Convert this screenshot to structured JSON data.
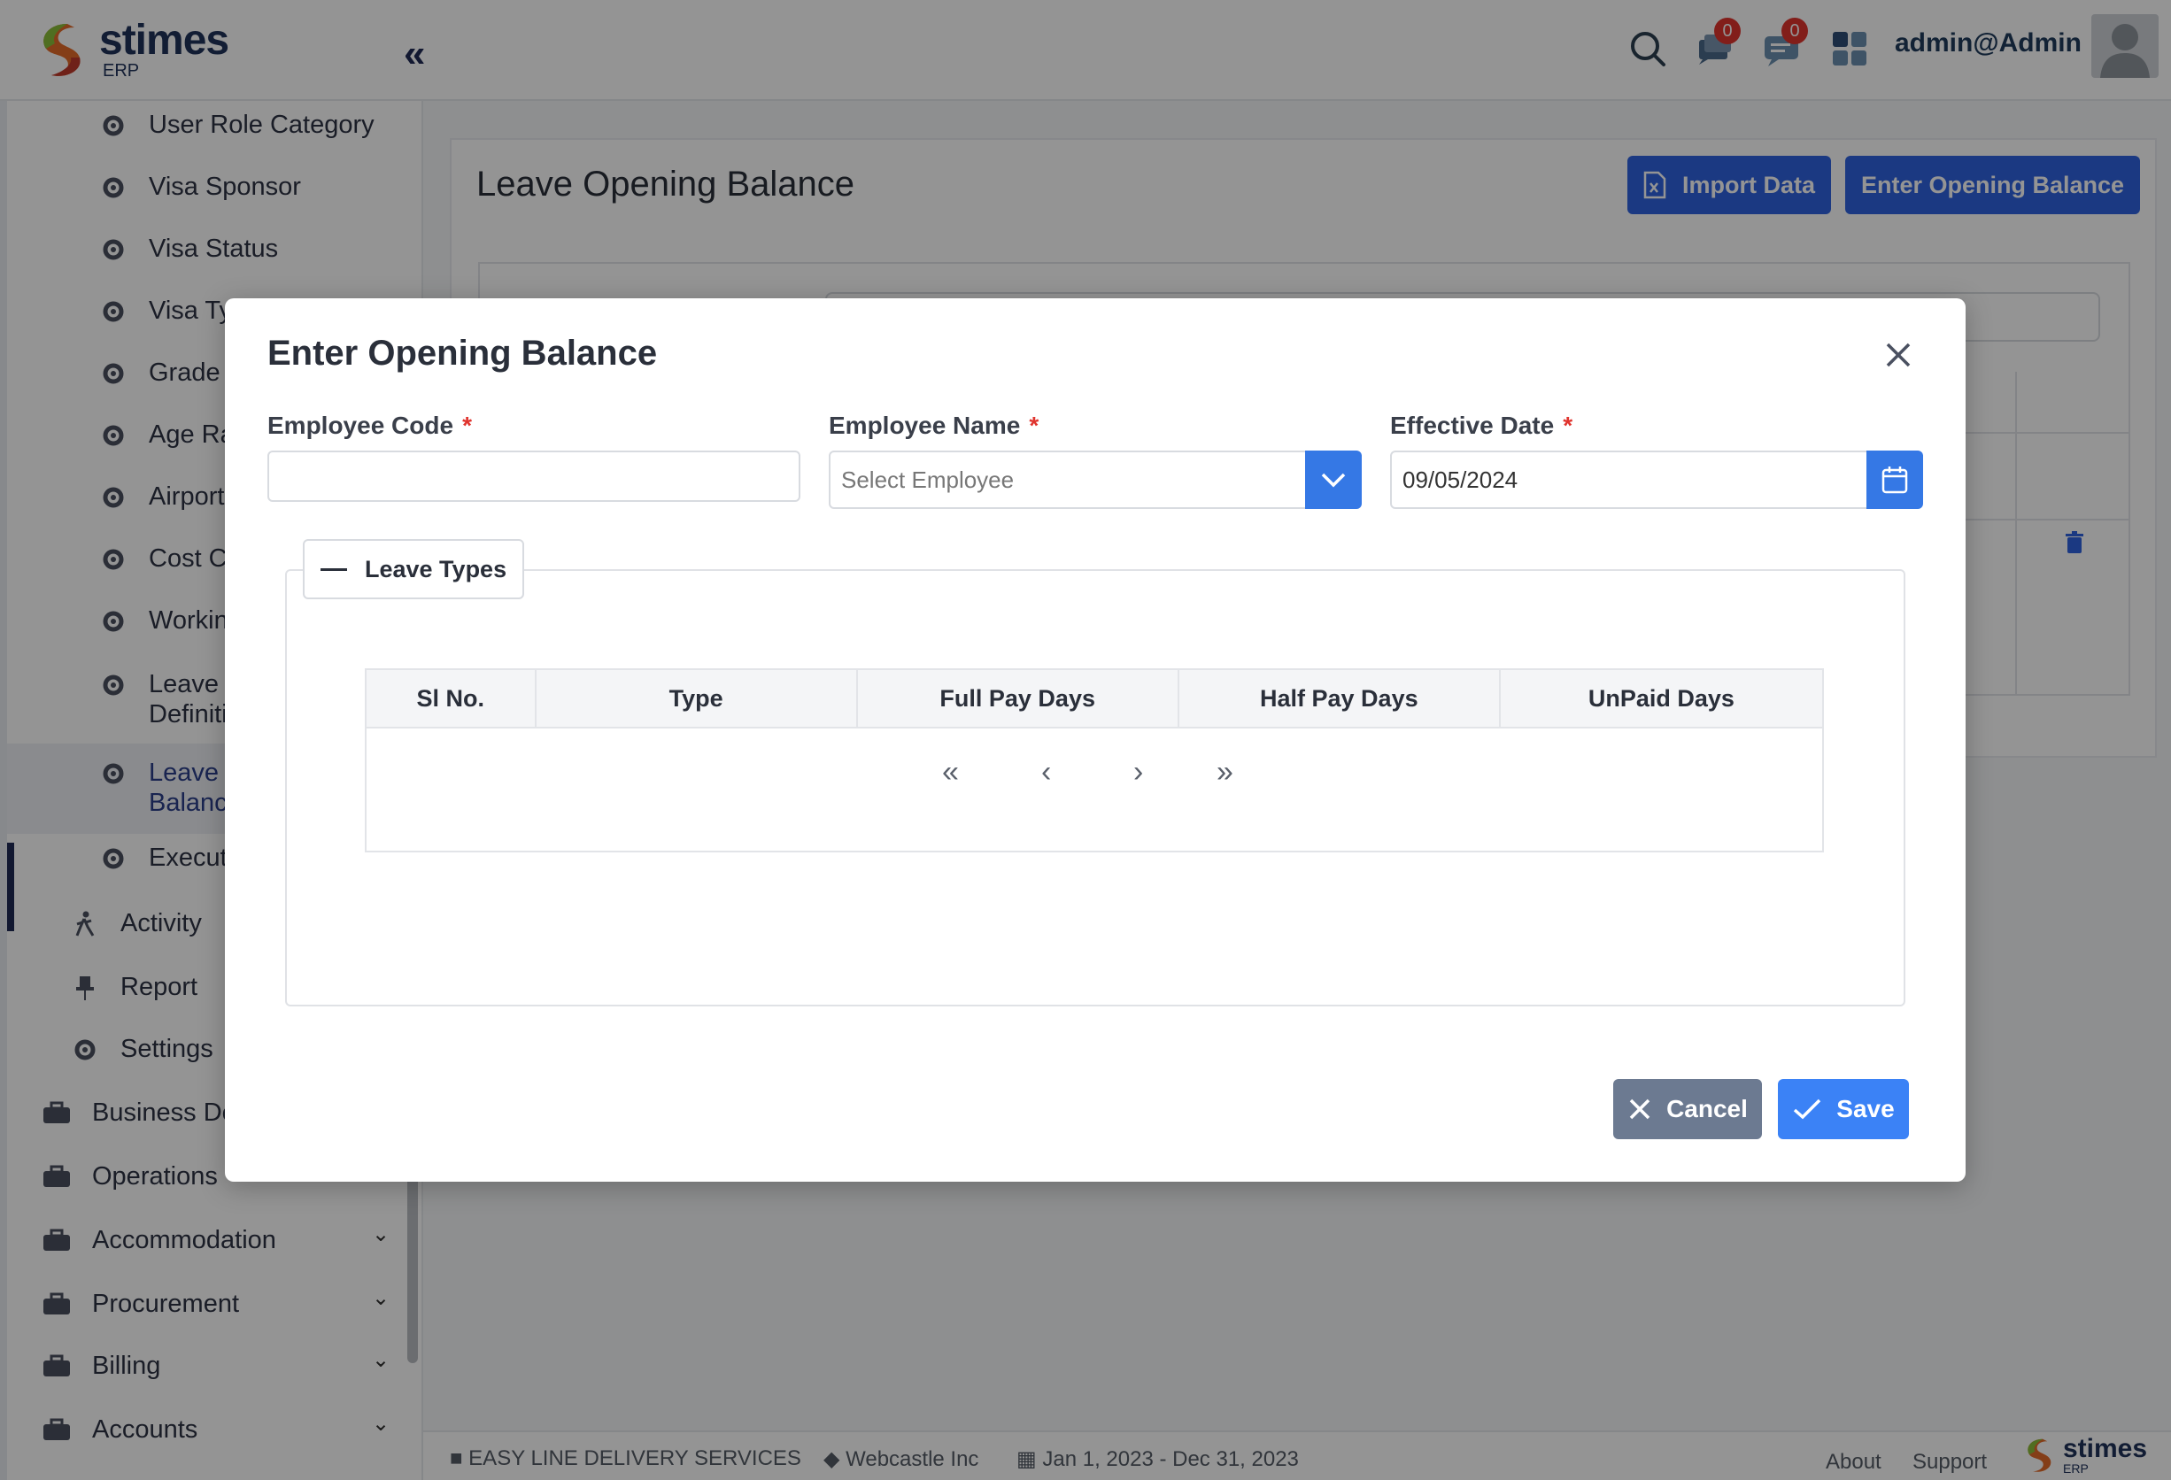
{
  "app": {
    "logo_text": "stimes",
    "logo_sub": "ERP",
    "collapse_icon": "«"
  },
  "header": {
    "notifications_count": "0",
    "messages_count": "0",
    "user": "admin@Admin"
  },
  "sidebar": {
    "items": [
      {
        "label": "User Role Category",
        "icon": "gear-icon"
      },
      {
        "label": "Visa Sponsor",
        "icon": "gear-icon"
      },
      {
        "label": "Visa Status",
        "icon": "gear-icon"
      },
      {
        "label": "Visa Ty",
        "icon": "gear-icon"
      },
      {
        "label": "Grade",
        "icon": "gear-icon"
      },
      {
        "label": "Age Ra",
        "icon": "gear-icon"
      },
      {
        "label": "Airport",
        "icon": "gear-icon"
      },
      {
        "label": "Cost C",
        "icon": "gear-icon"
      },
      {
        "label": "Workin",
        "icon": "gear-icon"
      },
      {
        "label": "Leave S\nDefiniti",
        "icon": "gear-icon"
      },
      {
        "label": "Leave C\nBalance",
        "icon": "gear-icon",
        "active": true
      },
      {
        "label": "Execut",
        "icon": "gear-icon"
      }
    ],
    "sections": [
      {
        "label": "Activity",
        "icon": "walk-icon"
      },
      {
        "label": "Report",
        "icon": "pin-icon"
      },
      {
        "label": "Settings",
        "icon": "gear-icon"
      }
    ],
    "modules": [
      {
        "label": "Business De",
        "icon": "briefcase-icon"
      },
      {
        "label": "Operations",
        "icon": "sliders-icon"
      },
      {
        "label": "Accommodation",
        "icon": "bed-icon"
      },
      {
        "label": "Procurement",
        "icon": "cart-icon"
      },
      {
        "label": "Billing",
        "icon": "invoice-icon"
      },
      {
        "label": "Accounts",
        "icon": "excel-icon"
      }
    ],
    "chevron": "⌄"
  },
  "page": {
    "title": "Leave Opening Balance",
    "import_label": "Import Data",
    "enter_label": "Enter Opening Balance"
  },
  "modal": {
    "title": "Enter Opening Balance",
    "employee_code_label": "Employee Code",
    "employee_code_value": "",
    "employee_name_label": "Employee Name",
    "employee_name_placeholder": "Select Employee",
    "effective_date_label": "Effective Date",
    "effective_date_value": "09/05/2024",
    "required_mark": "*",
    "legend": "Leave Types",
    "columns": [
      "Sl No.",
      "Type",
      "Full Pay Days",
      "Half Pay Days",
      "UnPaid Days"
    ],
    "pager": {
      "first": "«",
      "prev": "‹",
      "next": "›",
      "last": "»"
    },
    "cancel_label": "Cancel",
    "save_label": "Save"
  },
  "footer": {
    "company": "EASY LINE DELIVERY SERVICES",
    "vendor": "Webcastle Inc",
    "period": "Jan 1, 2023 - Dec 31, 2023",
    "about": "About",
    "support": "Support",
    "logo_text": "stimes",
    "logo_sub": "ERP"
  },
  "colors": {
    "primary": "#2f63e0",
    "save": "#3b82f6",
    "cancel": "#6c7a91",
    "danger": "#e0342e",
    "navy": "#1f2a55"
  }
}
